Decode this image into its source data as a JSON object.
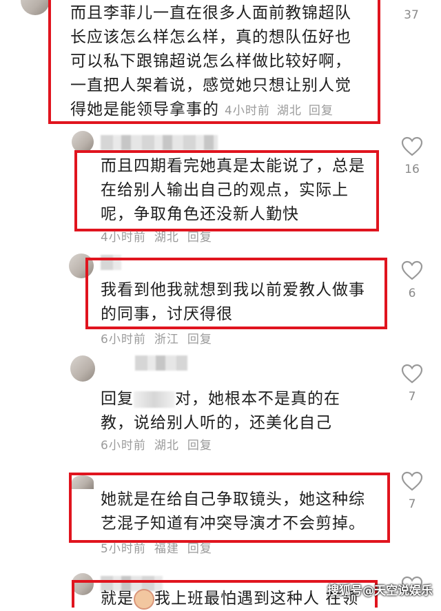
{
  "comments": [
    {
      "lines": [
        "而且李菲儿一直在很多人面前教锦超队",
        "长应该怎么样怎么样，真的想队伍好也",
        "可以私下跟锦超说怎么样做比较好啊，",
        "一直把人架着说，感觉她只想让别人觉",
        "得她是能领导拿事的"
      ],
      "time": "4小时前",
      "location": "湖北",
      "reply": "回复",
      "likes": "37"
    },
    {
      "lines": [
        "而且四期看完她真是太能说了，总是",
        "在给别人输出自己的观点，实际上",
        "呢，争取角色还没新人勤快"
      ],
      "time": "4小时前",
      "location": "湖北",
      "reply": "回复",
      "likes": "16"
    },
    {
      "lines": [
        "我看到他我就想到我以前爱教人做事",
        "的同事，讨厌得很"
      ],
      "time": "6小时前",
      "location": "浙江",
      "reply": "回复",
      "likes": "6"
    },
    {
      "reply_prefix": "回复",
      "lines": [
        "对，她根本不是真的在",
        "教，说给别人听的，还美化自己"
      ],
      "time": "6小时前",
      "location": "湖北",
      "reply": "回复",
      "likes": "7"
    },
    {
      "lines": [
        "她就是在给自己争取镜头，她这种综",
        "艺混子知道有冲突导演才不会剪掉。"
      ],
      "time": "5小时前",
      "location": "福建",
      "reply": "回复",
      "likes": "7"
    },
    {
      "lines_a": "就是",
      "lines_b": "我上班最怕遇到这种人 在领"
    }
  ],
  "watermark": "搜狐号@天空说娱乐",
  "colors": {
    "highlight": "#e0141e",
    "meta": "#9a9a9a"
  }
}
